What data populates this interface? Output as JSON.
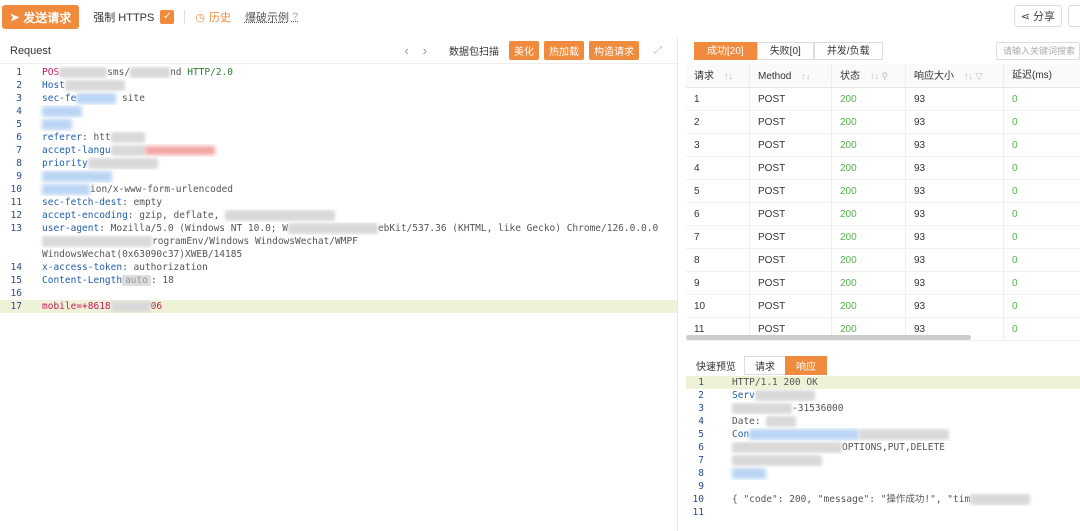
{
  "toolbar": {
    "send_label": "发送请求",
    "https_label": "强制 HTTPS",
    "history_label": "历史",
    "blast_label": "爆破示例",
    "share_label": "分享"
  },
  "request": {
    "title": "Request",
    "buttons": [
      "数据包扫描",
      "美化",
      "热加载",
      "构造请求"
    ],
    "lines": [
      {
        "n": "1",
        "parts": [
          [
            "kr",
            "POS"
          ],
          [
            "blur",
            ""
          ],
          [
            "t",
            "sms/"
          ],
          [
            "blur",
            ""
          ],
          [
            "t",
            "nd "
          ],
          [
            "kg",
            "HTTP/2.0"
          ]
        ]
      },
      {
        "n": "2",
        "parts": [
          [
            "k",
            "Host"
          ],
          [
            "blur",
            ""
          ]
        ]
      },
      {
        "n": "3",
        "parts": [
          [
            "k",
            "sec-fe"
          ],
          [
            "blurb",
            ""
          ],
          [
            "t",
            " site"
          ]
        ]
      },
      {
        "n": "4",
        "parts": [
          [
            "blurb",
            ""
          ]
        ]
      },
      {
        "n": "5",
        "parts": [
          [
            "blurb",
            ""
          ]
        ]
      },
      {
        "n": "6",
        "parts": [
          [
            "k",
            "referer"
          ],
          [
            "t",
            ": htt"
          ],
          [
            "blur",
            ""
          ]
        ]
      },
      {
        "n": "7",
        "parts": [
          [
            "k",
            "accept-langu"
          ],
          [
            "blur",
            ""
          ],
          [
            "blurr",
            ""
          ]
        ]
      },
      {
        "n": "8",
        "parts": [
          [
            "k",
            "priority"
          ],
          [
            "blur",
            ""
          ]
        ]
      },
      {
        "n": "9",
        "parts": [
          [
            "blurb",
            ""
          ]
        ]
      },
      {
        "n": "10",
        "parts": [
          [
            "blurb",
            ""
          ],
          [
            "t",
            "ion/x-www-form-urlencoded"
          ]
        ]
      },
      {
        "n": "11",
        "parts": [
          [
            "k",
            "sec-fetch-dest"
          ],
          [
            "t",
            ": empty"
          ]
        ]
      },
      {
        "n": "12",
        "parts": [
          [
            "k",
            "accept-encoding"
          ],
          [
            "t",
            ": gzip, deflate, "
          ],
          [
            "blur",
            ""
          ]
        ]
      },
      {
        "n": "13",
        "parts": [
          [
            "k",
            "user-agent"
          ],
          [
            "t",
            ": Mozilla/5.0 (Windows NT 10.0; W"
          ],
          [
            "blur",
            ""
          ],
          [
            "t",
            "ebKit/537.36 (KHTML, like Gecko) Chrome/126.0.0.0"
          ]
        ]
      },
      {
        "n": "",
        "parts": [
          [
            "blur",
            ""
          ],
          [
            "t",
            "rogramEnv/Windows WindowsWechat/WMPF"
          ]
        ]
      },
      {
        "n": "",
        "parts": [
          [
            "t",
            "WindowsWechat(0x63090c37)XWEB/14185"
          ]
        ]
      },
      {
        "n": "14",
        "parts": [
          [
            "k",
            "x-access-token"
          ],
          [
            "t",
            ": authorization"
          ]
        ]
      },
      {
        "n": "15",
        "parts": [
          [
            "k",
            "Content-Length"
          ],
          [
            "auto",
            "auto"
          ],
          [
            "t",
            ": 18"
          ]
        ]
      },
      {
        "n": "16",
        "parts": []
      },
      {
        "n": "17",
        "parts": [
          [
            "kr",
            "mobile=+8618"
          ],
          [
            "blur",
            ""
          ],
          [
            "kr",
            "06"
          ]
        ],
        "hl": true
      }
    ]
  },
  "results": {
    "tabs": [
      "成功[20]",
      "失败[0]",
      "并发/负载"
    ],
    "search_placeholder": "请输入关键词搜索",
    "columns": [
      "请求",
      "Method",
      "状态",
      "响应大小",
      "延迟(ms)"
    ],
    "rows": [
      [
        "1",
        "POST",
        "200",
        "93",
        "0"
      ],
      [
        "2",
        "POST",
        "200",
        "93",
        "0"
      ],
      [
        "3",
        "POST",
        "200",
        "93",
        "0"
      ],
      [
        "4",
        "POST",
        "200",
        "93",
        "0"
      ],
      [
        "5",
        "POST",
        "200",
        "93",
        "0"
      ],
      [
        "6",
        "POST",
        "200",
        "93",
        "0"
      ],
      [
        "7",
        "POST",
        "200",
        "93",
        "0"
      ],
      [
        "8",
        "POST",
        "200",
        "93",
        "0"
      ],
      [
        "9",
        "POST",
        "200",
        "93",
        "0"
      ],
      [
        "10",
        "POST",
        "200",
        "93",
        "0"
      ],
      [
        "11",
        "POST",
        "200",
        "93",
        "0"
      ]
    ]
  },
  "preview": {
    "label": "快速预览",
    "tabs": [
      "请求",
      "响应"
    ],
    "lines": [
      {
        "n": "1",
        "parts": [
          [
            "t",
            "HTTP/1.1 200 OK"
          ]
        ],
        "hl": true
      },
      {
        "n": "2",
        "parts": [
          [
            "k",
            "Serv"
          ],
          [
            "blur",
            ""
          ]
        ]
      },
      {
        "n": "3",
        "parts": [
          [
            "blur",
            ""
          ],
          [
            "t",
            "-31536000"
          ]
        ]
      },
      {
        "n": "4",
        "parts": [
          [
            "t",
            "Date: "
          ],
          [
            "blur",
            ""
          ]
        ]
      },
      {
        "n": "5",
        "parts": [
          [
            "k",
            "Con"
          ],
          [
            "blurb",
            ""
          ],
          [
            "blur",
            ""
          ]
        ]
      },
      {
        "n": "6",
        "parts": [
          [
            "blur",
            ""
          ],
          [
            "t",
            "OPTIONS,PUT,DELETE"
          ]
        ]
      },
      {
        "n": "7",
        "parts": [
          [
            "blur",
            ""
          ]
        ]
      },
      {
        "n": "8",
        "parts": [
          [
            "blurb",
            ""
          ]
        ]
      },
      {
        "n": "9",
        "parts": []
      },
      {
        "n": "10",
        "parts": [
          [
            "t",
            "{ \"code\": 200, \"message\": \"操作成功!\", \"tim"
          ],
          [
            "blur",
            ""
          ]
        ]
      },
      {
        "n": "11",
        "parts": []
      }
    ]
  }
}
